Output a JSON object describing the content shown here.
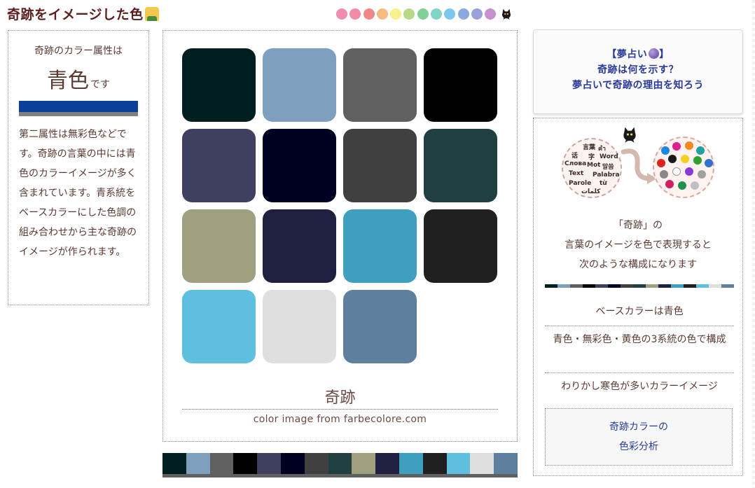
{
  "header": {
    "title": "奇跡をイメージした色",
    "dot_colors": [
      "#f08cb0",
      "#f28aa8",
      "#ee8888",
      "#f5bb80",
      "#f6f08a",
      "#b8d98a",
      "#7fcf96",
      "#80d4c8",
      "#7cc7ee",
      "#8aa9e0",
      "#9aa0d8",
      "#c890d0"
    ]
  },
  "left": {
    "heading": "奇跡のカラー属性は",
    "color_word": "青色",
    "color_suffix": "です",
    "bar_color": "#0a3f9a",
    "description": "第二属性は無彩色などです。奇跡の言葉の中には青色のカラーイメージが多く含まれています。青系統をベースカラーにした色調の組み合わせから主な奇跡のイメージが作られます。"
  },
  "center": {
    "tiles": [
      "#021f20",
      "#7f9fbf",
      "#606060",
      "#000000",
      "#3f4060",
      "#000020",
      "#404040",
      "#203f40",
      "#a09f80",
      "#1f203f",
      "#3f9fbf",
      "#202020",
      "#5fbfdf",
      "#dfdfdf",
      "#5f7f9f"
    ],
    "word": "奇跡",
    "credit": "color image from farbecolore.com"
  },
  "right": {
    "dream_line1": "【夢占い",
    "dream_line1_end": "】",
    "dream_line2": "奇跡は何を示す？",
    "dream_line3": "夢占いで奇跡の理由を知ろう",
    "illustration_words": [
      "言葉",
      "คำ",
      "话",
      "字",
      "Word",
      "Слова",
      "Mot",
      "말씀",
      "Text",
      "Palabra",
      "Parole",
      "từ",
      "كلمات"
    ],
    "intro_line1": "「奇跡」の",
    "intro_line2": "言葉のイメージを色で表現すると",
    "intro_line3": "次のような構成になります",
    "base_color": "ベースカラーは青色",
    "systems": "青色・無彩色・黄色の3系統の色で構成",
    "tendency": "わりかし寒色が多いカラーイメージ",
    "analysis_line1": "奇跡カラーの",
    "analysis_line2": "色彩分析"
  }
}
